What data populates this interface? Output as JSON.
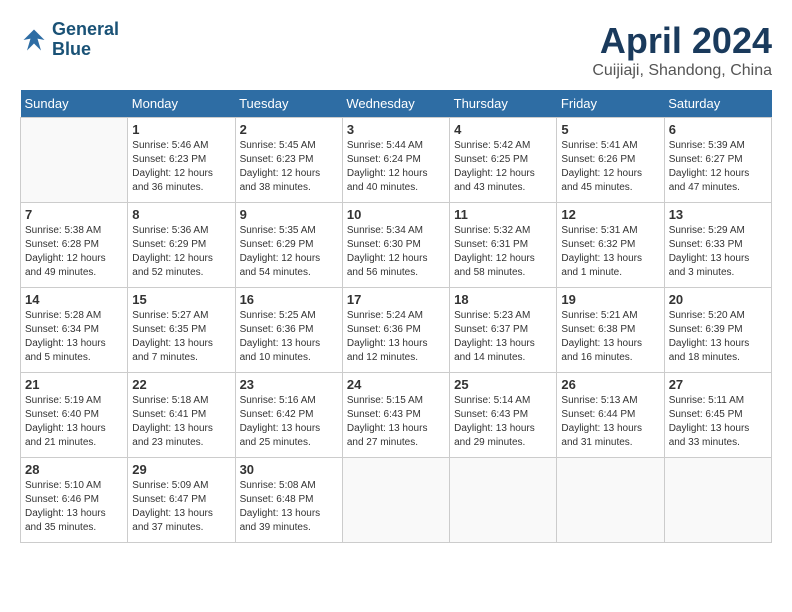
{
  "logo": {
    "line1": "General",
    "line2": "Blue"
  },
  "title": "April 2024",
  "subtitle": "Cuijiaji, Shandong, China",
  "weekdays": [
    "Sunday",
    "Monday",
    "Tuesday",
    "Wednesday",
    "Thursday",
    "Friday",
    "Saturday"
  ],
  "weeks": [
    [
      {
        "day": null,
        "info": null
      },
      {
        "day": "1",
        "info": "Sunrise: 5:46 AM\nSunset: 6:23 PM\nDaylight: 12 hours\nand 36 minutes."
      },
      {
        "day": "2",
        "info": "Sunrise: 5:45 AM\nSunset: 6:23 PM\nDaylight: 12 hours\nand 38 minutes."
      },
      {
        "day": "3",
        "info": "Sunrise: 5:44 AM\nSunset: 6:24 PM\nDaylight: 12 hours\nand 40 minutes."
      },
      {
        "day": "4",
        "info": "Sunrise: 5:42 AM\nSunset: 6:25 PM\nDaylight: 12 hours\nand 43 minutes."
      },
      {
        "day": "5",
        "info": "Sunrise: 5:41 AM\nSunset: 6:26 PM\nDaylight: 12 hours\nand 45 minutes."
      },
      {
        "day": "6",
        "info": "Sunrise: 5:39 AM\nSunset: 6:27 PM\nDaylight: 12 hours\nand 47 minutes."
      }
    ],
    [
      {
        "day": "7",
        "info": "Sunrise: 5:38 AM\nSunset: 6:28 PM\nDaylight: 12 hours\nand 49 minutes."
      },
      {
        "day": "8",
        "info": "Sunrise: 5:36 AM\nSunset: 6:29 PM\nDaylight: 12 hours\nand 52 minutes."
      },
      {
        "day": "9",
        "info": "Sunrise: 5:35 AM\nSunset: 6:29 PM\nDaylight: 12 hours\nand 54 minutes."
      },
      {
        "day": "10",
        "info": "Sunrise: 5:34 AM\nSunset: 6:30 PM\nDaylight: 12 hours\nand 56 minutes."
      },
      {
        "day": "11",
        "info": "Sunrise: 5:32 AM\nSunset: 6:31 PM\nDaylight: 12 hours\nand 58 minutes."
      },
      {
        "day": "12",
        "info": "Sunrise: 5:31 AM\nSunset: 6:32 PM\nDaylight: 13 hours\nand 1 minute."
      },
      {
        "day": "13",
        "info": "Sunrise: 5:29 AM\nSunset: 6:33 PM\nDaylight: 13 hours\nand 3 minutes."
      }
    ],
    [
      {
        "day": "14",
        "info": "Sunrise: 5:28 AM\nSunset: 6:34 PM\nDaylight: 13 hours\nand 5 minutes."
      },
      {
        "day": "15",
        "info": "Sunrise: 5:27 AM\nSunset: 6:35 PM\nDaylight: 13 hours\nand 7 minutes."
      },
      {
        "day": "16",
        "info": "Sunrise: 5:25 AM\nSunset: 6:36 PM\nDaylight: 13 hours\nand 10 minutes."
      },
      {
        "day": "17",
        "info": "Sunrise: 5:24 AM\nSunset: 6:36 PM\nDaylight: 13 hours\nand 12 minutes."
      },
      {
        "day": "18",
        "info": "Sunrise: 5:23 AM\nSunset: 6:37 PM\nDaylight: 13 hours\nand 14 minutes."
      },
      {
        "day": "19",
        "info": "Sunrise: 5:21 AM\nSunset: 6:38 PM\nDaylight: 13 hours\nand 16 minutes."
      },
      {
        "day": "20",
        "info": "Sunrise: 5:20 AM\nSunset: 6:39 PM\nDaylight: 13 hours\nand 18 minutes."
      }
    ],
    [
      {
        "day": "21",
        "info": "Sunrise: 5:19 AM\nSunset: 6:40 PM\nDaylight: 13 hours\nand 21 minutes."
      },
      {
        "day": "22",
        "info": "Sunrise: 5:18 AM\nSunset: 6:41 PM\nDaylight: 13 hours\nand 23 minutes."
      },
      {
        "day": "23",
        "info": "Sunrise: 5:16 AM\nSunset: 6:42 PM\nDaylight: 13 hours\nand 25 minutes."
      },
      {
        "day": "24",
        "info": "Sunrise: 5:15 AM\nSunset: 6:43 PM\nDaylight: 13 hours\nand 27 minutes."
      },
      {
        "day": "25",
        "info": "Sunrise: 5:14 AM\nSunset: 6:43 PM\nDaylight: 13 hours\nand 29 minutes."
      },
      {
        "day": "26",
        "info": "Sunrise: 5:13 AM\nSunset: 6:44 PM\nDaylight: 13 hours\nand 31 minutes."
      },
      {
        "day": "27",
        "info": "Sunrise: 5:11 AM\nSunset: 6:45 PM\nDaylight: 13 hours\nand 33 minutes."
      }
    ],
    [
      {
        "day": "28",
        "info": "Sunrise: 5:10 AM\nSunset: 6:46 PM\nDaylight: 13 hours\nand 35 minutes."
      },
      {
        "day": "29",
        "info": "Sunrise: 5:09 AM\nSunset: 6:47 PM\nDaylight: 13 hours\nand 37 minutes."
      },
      {
        "day": "30",
        "info": "Sunrise: 5:08 AM\nSunset: 6:48 PM\nDaylight: 13 hours\nand 39 minutes."
      },
      {
        "day": null,
        "info": null
      },
      {
        "day": null,
        "info": null
      },
      {
        "day": null,
        "info": null
      },
      {
        "day": null,
        "info": null
      }
    ]
  ]
}
